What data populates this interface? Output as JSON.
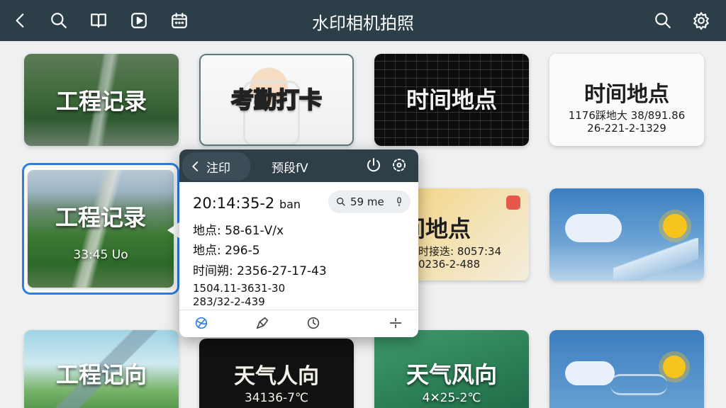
{
  "header": {
    "title": "水印相机拍照",
    "icons": [
      "back-icon",
      "search-icon",
      "book-icon",
      "play-icon",
      "calendar-icon",
      "search-icon",
      "gear-icon"
    ]
  },
  "cards": [
    {
      "title": "工程记录",
      "sub": ""
    },
    {
      "title": "考勤打卡",
      "sub": ""
    },
    {
      "title": "时间地点",
      "sub": ""
    },
    {
      "title": "时间地点",
      "sub1": "1176踩地大 38/891.86",
      "sub2": "26-221-2-1329"
    },
    {
      "title": "工程记录",
      "sub": "33:45 Uo"
    },
    {
      "title": "天间地点",
      "sub1": "时接迭: 8057:34",
      "sub2": "0236-2-488"
    },
    {
      "title": "",
      "sub": ""
    },
    {
      "title": "工程记向",
      "sub": ""
    },
    {
      "title": "天气人向",
      "sub": "34136-7℃"
    },
    {
      "title": "天气风向",
      "sub": "4✕25-2℃"
    },
    {
      "title": "",
      "sub": ""
    }
  ],
  "popup": {
    "back_label": "注印",
    "title": "预段fV",
    "time": "20:14:35-2",
    "time_suffix": "ban",
    "search_value": "59 me",
    "line1": "地点: 58-61-V/x",
    "line2": "地点: 296-5",
    "line3": "时间朔: 2356-27-17-43",
    "line4": "1504.11-3631-30",
    "line5": "283/32-2-439"
  },
  "colors": {
    "accent": "#2a7fe0",
    "topbar": "#2c3e47"
  }
}
